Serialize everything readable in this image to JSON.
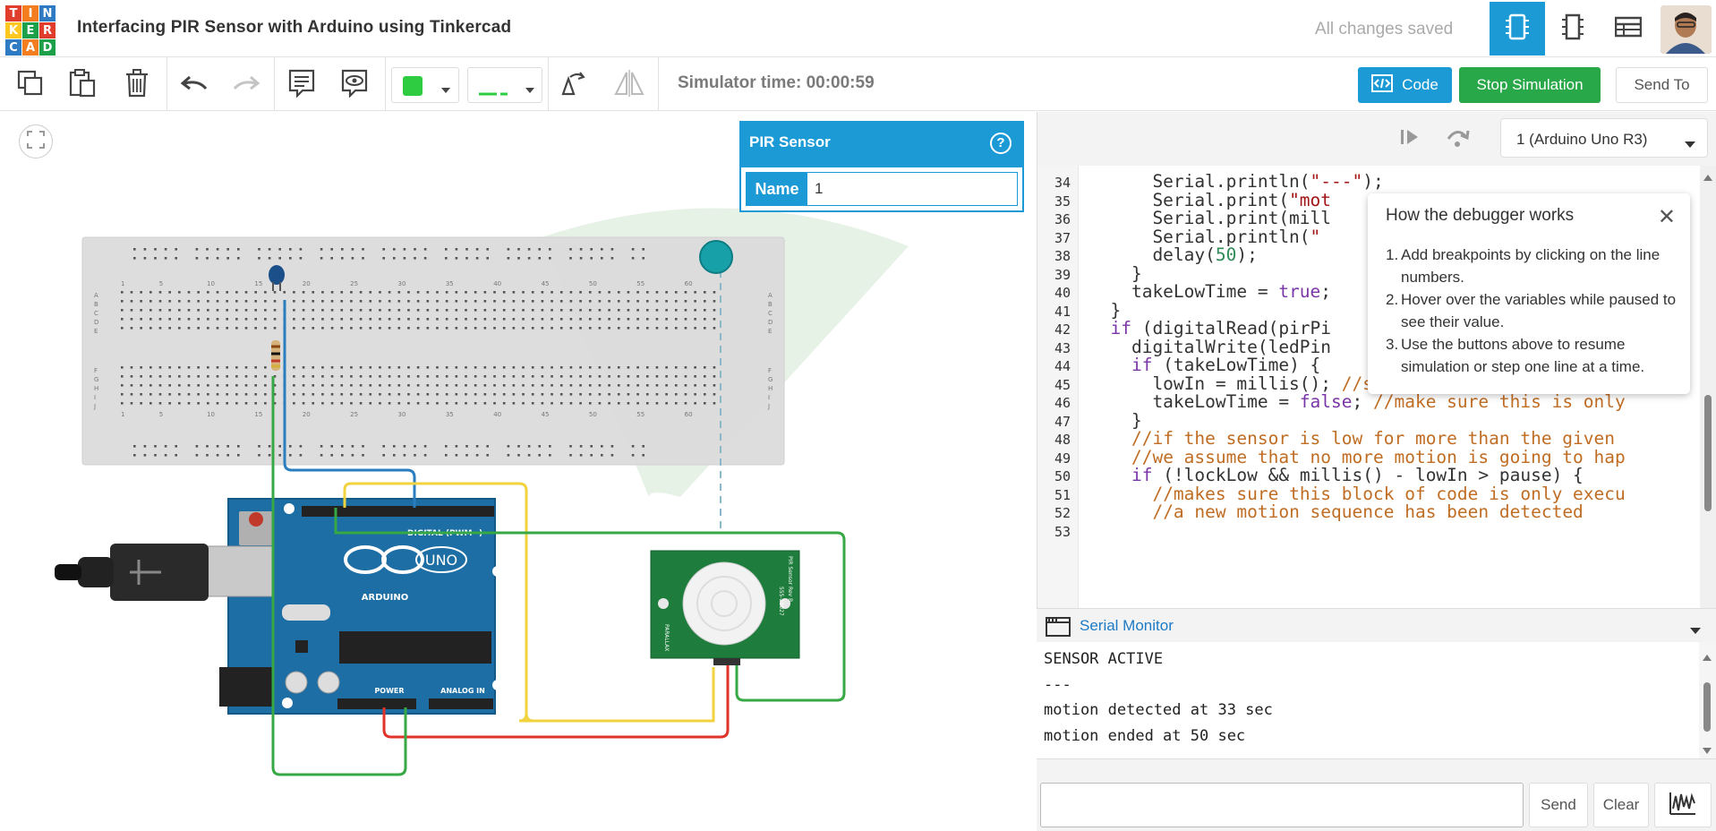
{
  "app": {
    "title": "Interfacing PIR Sensor with Arduino using Tinkercad",
    "save_status": "All changes saved",
    "logo_letters": [
      "T",
      "I",
      "N",
      "K",
      "E",
      "R",
      "C",
      "A",
      "D"
    ],
    "logo_colors": [
      "#e13d2d",
      "#f47d20",
      "#2e7bc4",
      "#fec821",
      "#1da04a",
      "#e13d2d",
      "#2e7bc4",
      "#f47d20",
      "#1da04a"
    ]
  },
  "toolbar": {
    "simulator_time": "Simulator time: 00:00:59",
    "code_label": "Code",
    "stop_label": "Stop Simulation",
    "send_to_label": "Send To",
    "fill_color": "#2ecc40"
  },
  "inspector": {
    "title": "PIR Sensor",
    "help": "?",
    "name_label": "Name",
    "name_value": "1"
  },
  "code_panel": {
    "device": "1 (Arduino Uno R3)",
    "lines": [
      {
        "n": "34",
        "segs": [
          {
            "t": "      Serial.println(",
            "c": ""
          },
          {
            "t": "\"---\"",
            "c": "str"
          },
          {
            "t": ");",
            "c": ""
          }
        ]
      },
      {
        "n": "35",
        "segs": [
          {
            "t": "      Serial.print(",
            "c": ""
          },
          {
            "t": "\"mot",
            "c": "str"
          }
        ]
      },
      {
        "n": "36",
        "segs": [
          {
            "t": "      Serial.print(mill",
            "c": ""
          }
        ]
      },
      {
        "n": "37",
        "segs": [
          {
            "t": "      Serial.println(",
            "c": ""
          },
          {
            "t": "\"",
            "c": "str"
          }
        ]
      },
      {
        "n": "38",
        "segs": [
          {
            "t": "      delay(",
            "c": ""
          },
          {
            "t": "50",
            "c": "num"
          },
          {
            "t": ");",
            "c": ""
          }
        ]
      },
      {
        "n": "39",
        "segs": [
          {
            "t": "    }",
            "c": ""
          }
        ]
      },
      {
        "n": "40",
        "segs": [
          {
            "t": "    takeLowTime = ",
            "c": ""
          },
          {
            "t": "true",
            "c": "kw"
          },
          {
            "t": ";",
            "c": ""
          }
        ]
      },
      {
        "n": "41",
        "segs": [
          {
            "t": "  }",
            "c": ""
          }
        ]
      },
      {
        "n": "42",
        "segs": [
          {
            "t": "  ",
            "c": ""
          },
          {
            "t": "if",
            "c": "kw"
          },
          {
            "t": " (digitalRead(pirPi",
            "c": ""
          }
        ]
      },
      {
        "n": "43",
        "segs": [
          {
            "t": "    digitalWrite(ledPin",
            "c": ""
          }
        ]
      },
      {
        "n": "44",
        "segs": [
          {
            "t": "    ",
            "c": ""
          },
          {
            "t": "if",
            "c": "kw"
          },
          {
            "t": " (takeLowTime) {",
            "c": ""
          }
        ]
      },
      {
        "n": "45",
        "segs": [
          {
            "t": "      lowIn = millis(); ",
            "c": ""
          },
          {
            "t": "//save the time of the tran",
            "c": "cm"
          }
        ]
      },
      {
        "n": "46",
        "segs": [
          {
            "t": "      takeLowTime = ",
            "c": ""
          },
          {
            "t": "false",
            "c": "kw"
          },
          {
            "t": "; ",
            "c": ""
          },
          {
            "t": "//make sure this is only",
            "c": "cm"
          }
        ]
      },
      {
        "n": "47",
        "segs": [
          {
            "t": "    }",
            "c": ""
          }
        ]
      },
      {
        "n": "48",
        "segs": [
          {
            "t": "    ",
            "c": ""
          },
          {
            "t": "//if the sensor is low for more than the given",
            "c": "cm"
          }
        ]
      },
      {
        "n": "49",
        "segs": [
          {
            "t": "    ",
            "c": ""
          },
          {
            "t": "//we assume that no more motion is going to hap",
            "c": "cm"
          }
        ]
      },
      {
        "n": "50",
        "segs": [
          {
            "t": "    ",
            "c": ""
          },
          {
            "t": "if",
            "c": "kw"
          },
          {
            "t": " (!lockLow && millis() - lowIn > pause) {",
            "c": ""
          }
        ]
      },
      {
        "n": "51",
        "segs": [
          {
            "t": "      ",
            "c": ""
          },
          {
            "t": "//makes sure this block of code is only execu",
            "c": "cm"
          }
        ]
      },
      {
        "n": "52",
        "segs": [
          {
            "t": "      ",
            "c": ""
          },
          {
            "t": "//a new motion sequence has been detected",
            "c": "cm"
          }
        ]
      },
      {
        "n": "53",
        "segs": [
          {
            "t": "",
            "c": ""
          }
        ]
      }
    ]
  },
  "debugger_tip": {
    "title": "How the debugger works",
    "close": "✕",
    "steps": [
      "Add breakpoints by clicking on the line numbers.",
      "Hover over the variables while paused to see their value.",
      "Use the buttons above to resume simulation or step one line at a time."
    ]
  },
  "serial_monitor": {
    "title": "Serial Monitor",
    "lines": [
      "SENSOR ACTIVE",
      "---",
      "motion detected at 33 sec",
      "motion ended at 50 sec"
    ],
    "send_label": "Send",
    "clear_label": "Clear"
  },
  "breadboard": {
    "column_numbers": [
      "1",
      "5",
      "10",
      "15",
      "20",
      "25",
      "30",
      "35",
      "40",
      "45",
      "50",
      "55",
      "60"
    ],
    "row_letters_top": [
      "A",
      "B",
      "C",
      "D",
      "E"
    ],
    "row_letters_bottom": [
      "F",
      "G",
      "H",
      "I",
      "J"
    ]
  },
  "arduino": {
    "brand": "ARDUINO",
    "model": "UNO",
    "digital_label": "DIGITAL (PWM~)",
    "power_label": "POWER",
    "analog_label": "ANALOG IN"
  },
  "pir_module": {
    "brand": "PARALLAX",
    "model": "PIR Sensor Rev B",
    "part": "555-28027"
  }
}
